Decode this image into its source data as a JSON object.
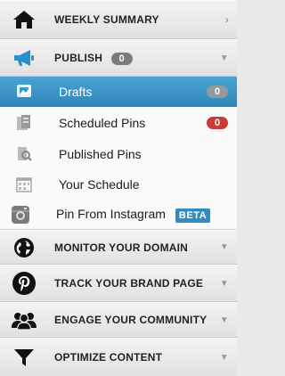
{
  "sections": {
    "weekly_summary": "WEEKLY SUMMARY",
    "publish": "PUBLISH",
    "publish_count": "0",
    "monitor": "MONITOR YOUR DOMAIN",
    "track": "TRACK YOUR BRAND PAGE",
    "engage": "ENGAGE YOUR COMMUNITY",
    "optimize": "OPTIMIZE CONTENT"
  },
  "publish_items": {
    "drafts": "Drafts",
    "drafts_count": "0",
    "scheduled": "Scheduled Pins",
    "scheduled_count": "0",
    "published": "Published Pins",
    "schedule": "Your Schedule",
    "instagram": "Pin From Instagram",
    "instagram_badge": "BETA"
  },
  "icons": {
    "home": "home-icon",
    "publish": "megaphone-icon",
    "drafts": "drafts-icon",
    "scheduled": "scheduled-pins-icon",
    "published": "published-pins-icon",
    "schedule": "calendar-icon",
    "instagram": "instagram-icon",
    "monitor": "globe-icon",
    "track": "pinterest-icon",
    "engage": "people-icon",
    "optimize": "funnel-icon"
  },
  "colors": {
    "active": "#3a96c8",
    "badge_red": "#cc3b36",
    "badge_grey": "#7c7c7c",
    "beta": "#2e8dc4"
  }
}
